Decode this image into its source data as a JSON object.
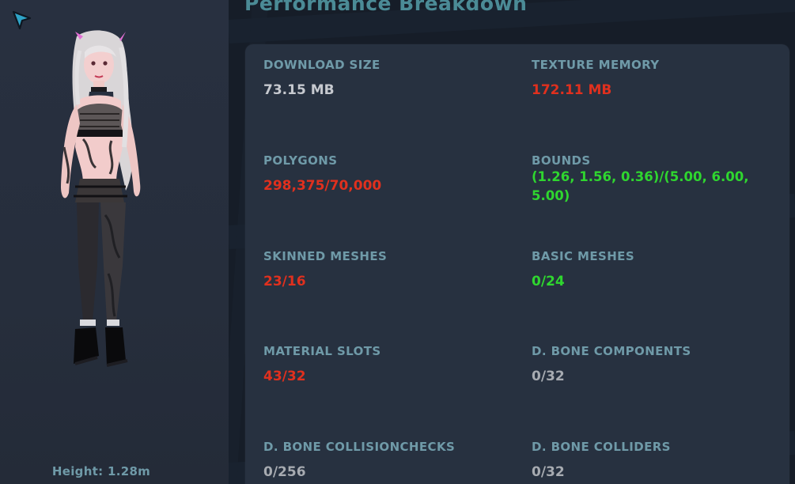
{
  "avatar_panel": {
    "height_text": "Height: 1.28m"
  },
  "breakdown": {
    "title": "Performance Breakdown",
    "stats": [
      {
        "label": "DOWNLOAD SIZE",
        "value": "73.15 MB",
        "status": "normal"
      },
      {
        "label": "TEXTURE MEMORY",
        "value": "172.11 MB",
        "status": "bad"
      },
      {
        "label": "POLYGONS",
        "value": "298,375/70,000",
        "status": "bad"
      },
      {
        "label": "BOUNDS",
        "value": "(1.26, 1.56, 0.36)/(5.00, 6.00, 5.00)",
        "status": "good"
      },
      {
        "label": "SKINNED MESHES",
        "value": "23/16",
        "status": "bad"
      },
      {
        "label": "BASIC MESHES",
        "value": "0/24",
        "status": "good"
      },
      {
        "label": "MATERIAL SLOTS",
        "value": "43/32",
        "status": "bad"
      },
      {
        "label": "D. BONE COMPONENTS",
        "value": "0/32",
        "status": "neutral"
      },
      {
        "label": "D. BONE COLLISIONCHECKS",
        "value": "0/256",
        "status": "neutral"
      },
      {
        "label": "D. BONE COLLIDERS",
        "value": "0/32",
        "status": "neutral"
      }
    ]
  },
  "colors": {
    "label": "#6f9aa8",
    "title": "#4b8b96",
    "normal": "#c6c9cf",
    "neutral": "#a7abb1",
    "bad": "#e0301e",
    "good": "#2fd62f",
    "card": "#273140",
    "panel": "#283040"
  },
  "icons": {
    "cursor": "pointer-cursor-icon"
  }
}
